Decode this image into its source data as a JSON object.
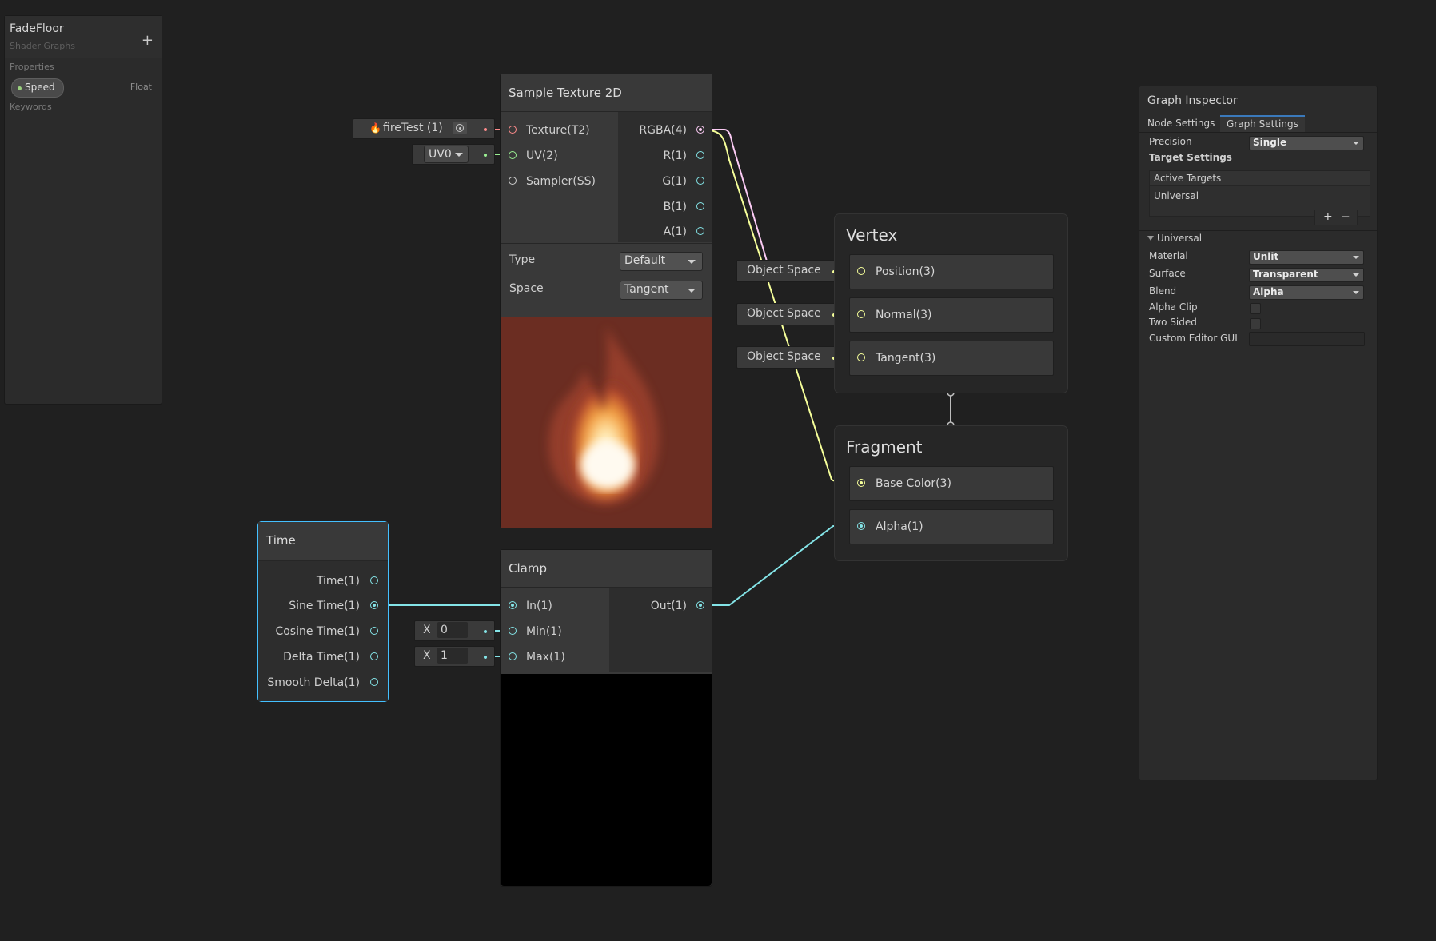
{
  "blackboard": {
    "title": "FadeFloor",
    "subtitle": "Shader Graphs",
    "add_label": "+",
    "properties_label": "Properties",
    "property": {
      "name": "Speed",
      "type": "Float"
    },
    "keywords_label": "Keywords"
  },
  "sample_texture": {
    "title": "Sample Texture 2D",
    "inputs": [
      "Texture(T2)",
      "UV(2)",
      "Sampler(SS)"
    ],
    "outputs": [
      "RGBA(4)",
      "R(1)",
      "G(1)",
      "B(1)",
      "A(1)"
    ],
    "type_label": "Type",
    "type_value": "Default",
    "space_label": "Space",
    "space_value": "Tangent",
    "texture_field": "fireTest (1)",
    "uv_field": "UV0"
  },
  "time_node": {
    "title": "Time",
    "outputs": [
      "Time(1)",
      "Sine Time(1)",
      "Cosine Time(1)",
      "Delta Time(1)",
      "Smooth Delta(1)"
    ]
  },
  "clamp_node": {
    "title": "Clamp",
    "inputs": [
      "In(1)",
      "Min(1)",
      "Max(1)"
    ],
    "output": "Out(1)",
    "min": {
      "axis": "X",
      "value": "0"
    },
    "max": {
      "axis": "X",
      "value": "1"
    }
  },
  "vertex": {
    "title": "Vertex",
    "blocks": [
      "Position(3)",
      "Normal(3)",
      "Tangent(3)"
    ],
    "space_label": "Object Space"
  },
  "fragment": {
    "title": "Fragment",
    "blocks": [
      "Base Color(3)",
      "Alpha(1)"
    ]
  },
  "inspector": {
    "title": "Graph Inspector",
    "tabs": [
      "Node Settings",
      "Graph Settings"
    ],
    "active_tab": "Graph Settings",
    "precision_label": "Precision",
    "precision_value": "Single",
    "target_settings_label": "Target Settings",
    "active_targets_label": "Active Targets",
    "active_target": "Universal",
    "add_label": "+",
    "remove_label": "−",
    "section_label": "Universal",
    "material_label": "Material",
    "material_value": "Unlit",
    "surface_label": "Surface",
    "surface_value": "Transparent",
    "blend_label": "Blend",
    "blend_value": "Alpha",
    "alpha_clip_label": "Alpha Clip",
    "alpha_clip": false,
    "two_sided_label": "Two Sided",
    "two_sided": false,
    "custom_editor_label": "Custom Editor GUI",
    "custom_editor_value": ""
  },
  "colors": {
    "float_port": "#84e4e7",
    "vector2_port": "#9aef92",
    "vector3_port": "#f6ff9a",
    "vector4_port": "#fbcbf4",
    "texture_port": "#ff8b8b",
    "selected_outline": "#44c0ff"
  }
}
